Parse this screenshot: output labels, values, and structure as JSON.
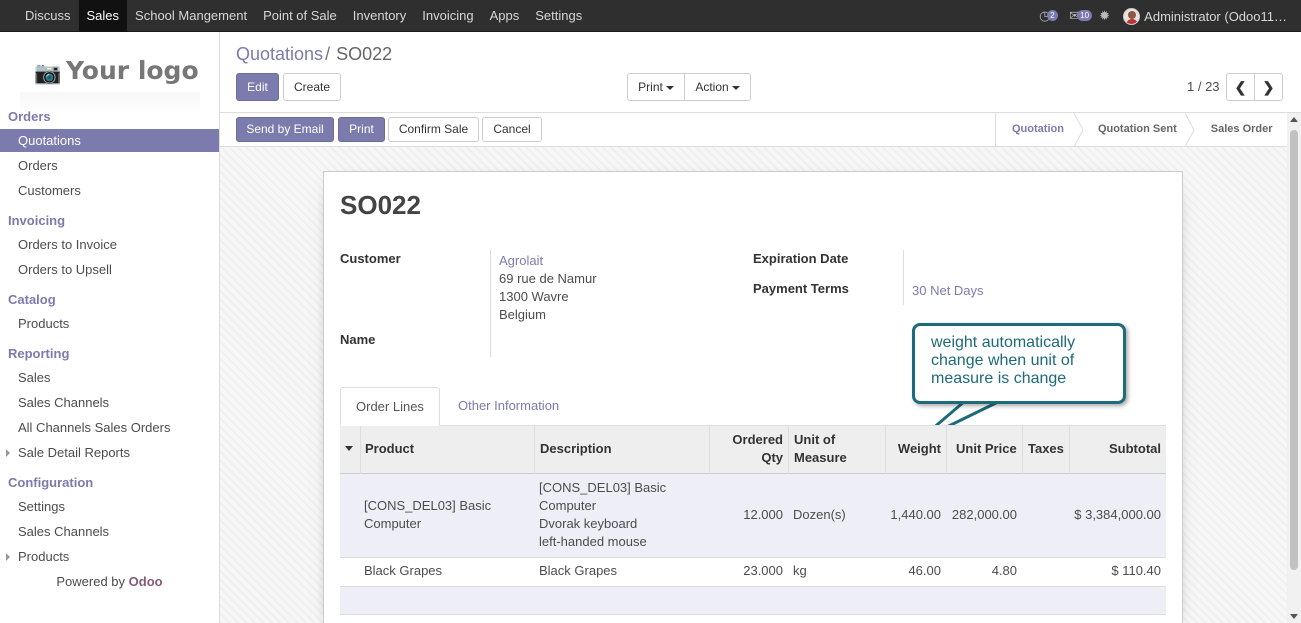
{
  "topbar": {
    "menu": [
      "Discuss",
      "Sales",
      "School Mangement",
      "Point of Sale",
      "Inventory",
      "Invoicing",
      "Apps",
      "Settings"
    ],
    "active": "Sales",
    "activity_count": "2",
    "messages_count": "10",
    "user": "Administrator (Odoo11…"
  },
  "sidebar": {
    "logo_text": "Your logo",
    "sections": {
      "orders": "Orders",
      "invoicing": "Invoicing",
      "catalog": "Catalog",
      "reporting": "Reporting",
      "configuration": "Configuration"
    },
    "items": {
      "quotations": "Quotations",
      "orders": "Orders",
      "customers": "Customers",
      "orders_to_invoice": "Orders to Invoice",
      "orders_to_upsell": "Orders to Upsell",
      "products": "Products",
      "sales": "Sales",
      "sales_channels": "Sales Channels",
      "all_channels": "All Channels Sales Orders",
      "sale_detail_reports": "Sale Detail Reports",
      "settings": "Settings",
      "config_sales_channels": "Sales Channels",
      "config_products": "Products"
    },
    "powered_by": "Powered by",
    "powered_brand": "Odoo"
  },
  "control": {
    "breadcrumb_parent": "Quotations",
    "breadcrumb_sep": "/",
    "breadcrumb_current": "SO022",
    "edit": "Edit",
    "create": "Create",
    "print": "Print",
    "action": "Action",
    "pager": "1 / 23"
  },
  "status": {
    "buttons": [
      "Send by Email",
      "Print",
      "Confirm Sale",
      "Cancel"
    ],
    "stages": [
      "Quotation",
      "Quotation Sent",
      "Sales Order"
    ],
    "active_stage": "Quotation"
  },
  "form": {
    "title": "SO022",
    "customer_label": "Customer",
    "customer_name": "Agrolait",
    "address": [
      "69 rue de Namur",
      "1300 Wavre",
      "Belgium"
    ],
    "name_label": "Name",
    "expiration_label": "Expiration Date",
    "payment_terms_label": "Payment Terms",
    "payment_terms": "30 Net Days"
  },
  "callout": "weight automatically change when unit of measure is change",
  "tabs": [
    "Order Lines",
    "Other Information"
  ],
  "table": {
    "headers": {
      "product": "Product",
      "description": "Description",
      "ordered_qty": [
        "Ordered",
        "Qty"
      ],
      "uom": [
        "Unit of",
        "Measure"
      ],
      "weight": "Weight",
      "unit_price": "Unit Price",
      "taxes": "Taxes",
      "subtotal": "Subtotal"
    },
    "rows": [
      {
        "product": [
          "[CONS_DEL03] Basic",
          "Computer"
        ],
        "description": [
          "[CONS_DEL03] Basic",
          "Computer",
          "Dvorak keyboard",
          "left-handed mouse"
        ],
        "qty": "12.000",
        "uom": "Dozen(s)",
        "weight": "1,440.00",
        "unit_price": "282,000.00",
        "taxes": "",
        "subtotal": "$ 3,384,000.00"
      },
      {
        "product": [
          "Black Grapes"
        ],
        "description": [
          "Black Grapes"
        ],
        "qty": "23.000",
        "uom": "kg",
        "weight": "46.00",
        "unit_price": "4.80",
        "taxes": "",
        "subtotal": "$ 110.40"
      }
    ]
  },
  "colors": {
    "brand": "#7c7bad",
    "callout": "#1d6a7b",
    "navbar": "#2f2f2f"
  }
}
